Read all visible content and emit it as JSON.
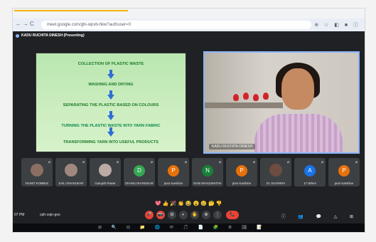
{
  "browser": {
    "url": "meet.google.com/ghi-wpvb-hkw?authuser=0",
    "nav_icons": [
      "←",
      "→",
      "C"
    ],
    "right_icons": "⊕ ☆ ◧ ■ ⓘ"
  },
  "meet": {
    "presenter_label": "KADU RUCHITA DINESH (Presenting)"
  },
  "slide": {
    "steps": [
      "COLLECTION OF PLASTIC WASTE",
      "WASHING AND DRYING",
      "SEPARATING THE PLASTIC BASED ON COLOURS",
      "TURNING THE PLASTIC WASTE INTO YARN FABRIC",
      "TRANSFORMING YARN INTO USEFUL PRODUCTS"
    ]
  },
  "video": {
    "label": "KADU RUCHITA DINESH"
  },
  "tiles": [
    {
      "name": "NAINIT KOMBLE",
      "type": "photo",
      "color": "#8d6e63"
    },
    {
      "name": "SAILI DHANUKAR",
      "type": "photo",
      "color": "#a1887f"
    },
    {
      "name": "Gurupriti Pawar",
      "type": "photo",
      "color": "#bcaaa4"
    },
    {
      "name": "DHANU DHANUKAR",
      "type": "avatar",
      "letter": "D",
      "color": "#34a853"
    },
    {
      "name": "poor sunshine",
      "type": "avatar",
      "letter": "P",
      "color": "#e8710a"
    },
    {
      "name": "NANI MANJUNATHA",
      "type": "avatar",
      "letter": "N",
      "color": "#188038"
    },
    {
      "name": "poor sunshine",
      "type": "avatar",
      "letter": "P",
      "color": "#e8710a"
    },
    {
      "name": "Dr. SUVARNA",
      "type": "photo",
      "color": "#6d4c41"
    },
    {
      "name": "17 others",
      "type": "avatar",
      "letter": "A",
      "color": "#1a73e8"
    },
    {
      "name": "poor sunshine",
      "type": "avatar",
      "letter": "P",
      "color": "#e8710a"
    }
  ],
  "reactions": "💖👍🎉👏😂😮😢🤔👎",
  "bottom": {
    "time": "07 PM",
    "meeting_code": "cph-cejn-gvo"
  },
  "controls": [
    "🎤",
    "📷",
    "⊟",
    "◐",
    "🖐",
    "⊕",
    "⋮",
    "📞"
  ],
  "right_icons": "ⓘ 👥 💬 △ ⊞",
  "taskbar_icons": "⊞ 🔍 ⊟ 📁 🌐 ✉ 🎵 📄 🧩 ⚙ 🖼 📝"
}
